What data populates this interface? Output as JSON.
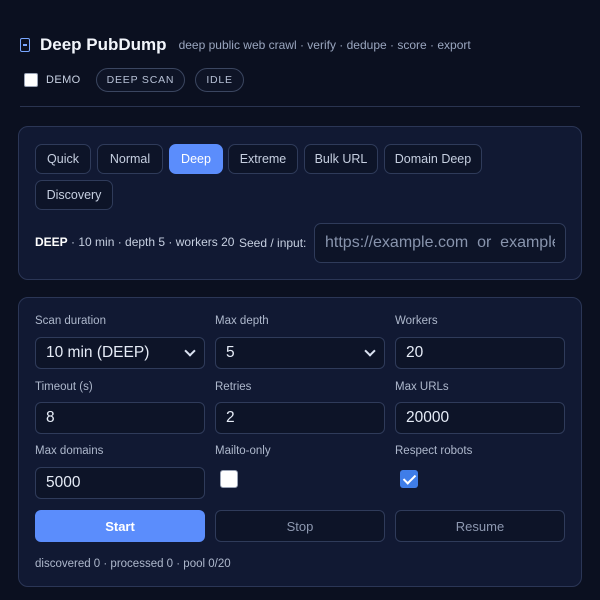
{
  "header": {
    "title": "Deep PubDump",
    "subtitle": "deep public web crawl · verify · dedupe · score · export",
    "logo_icon": "document-icon"
  },
  "status": {
    "demo_label": "DEMO",
    "demo_checked": false,
    "badges": [
      "DEEP SCAN",
      "IDLE"
    ]
  },
  "modes": {
    "tabs": [
      "Quick",
      "Normal",
      "Deep",
      "Extreme",
      "Bulk URL",
      "Domain Deep",
      "Discovery"
    ],
    "active": "Deep",
    "info_mode": "DEEP",
    "info_detail": " · 10 min · depth 5 · workers 20",
    "seed_label": "Seed / input:",
    "seed_placeholder": "https://example.com  or  example.com",
    "seed_value": ""
  },
  "settings": {
    "scan_duration": {
      "label": "Scan duration",
      "value": "10 min (DEEP)"
    },
    "max_depth": {
      "label": "Max depth",
      "value": "5"
    },
    "workers": {
      "label": "Workers",
      "value": "20"
    },
    "timeout": {
      "label": "Timeout (s)",
      "value": "8"
    },
    "retries": {
      "label": "Retries",
      "value": "2"
    },
    "max_urls": {
      "label": "Max URLs",
      "value": "20000"
    },
    "max_domains": {
      "label": "Max domains",
      "value": "5000"
    },
    "mailto_only": {
      "label": "Mailto-only",
      "checked": false
    },
    "respect_robots": {
      "label": "Respect robots",
      "checked": true
    }
  },
  "actions": {
    "start": "Start",
    "stop": "Stop",
    "resume": "Resume"
  },
  "stats": "discovered 0 · processed 0 · pool 0/20",
  "colors": {
    "background": "#0b1020",
    "panel": "#111933",
    "accent": "#5b8dfc",
    "checkbox_checked": "#3f7de8"
  }
}
